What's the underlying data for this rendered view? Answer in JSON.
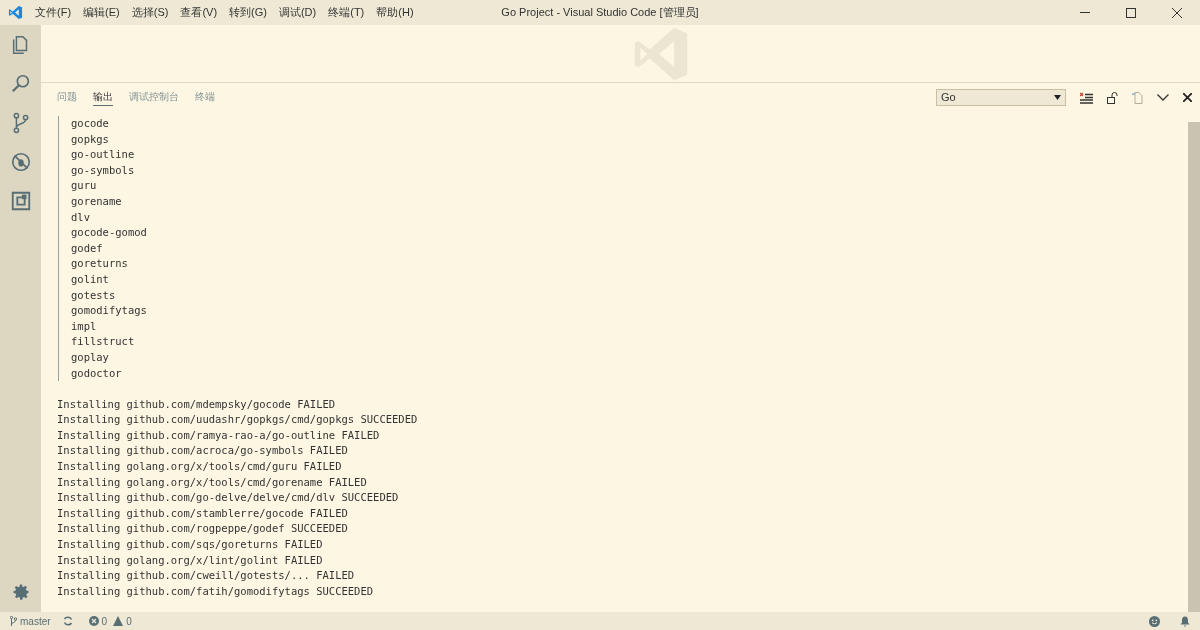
{
  "window": {
    "title": "Go Project - Visual Studio Code [管理员]"
  },
  "menu": [
    "文件(F)",
    "编辑(E)",
    "选择(S)",
    "查看(V)",
    "转到(G)",
    "调试(D)",
    "终端(T)",
    "帮助(H)"
  ],
  "activity_bar": [
    {
      "kind": "files"
    },
    {
      "kind": "search"
    },
    {
      "kind": "git"
    },
    {
      "kind": "debug"
    },
    {
      "kind": "extensions"
    }
  ],
  "panel": {
    "tabs": [
      {
        "label": "问题",
        "selected": false
      },
      {
        "label": "输出",
        "selected": true
      },
      {
        "label": "调试控制台",
        "selected": false
      },
      {
        "label": "终端",
        "selected": false
      }
    ],
    "channel_select": {
      "value": "Go"
    },
    "output": [
      {
        "kind": "indented",
        "lines": [
          "gocode",
          "gopkgs",
          "go-outline",
          "go-symbols",
          "guru",
          "gorename",
          "dlv",
          "gocode-gomod",
          "godef",
          "goreturns",
          "golint",
          "gotests",
          "gomodifytags",
          "impl",
          "fillstruct",
          "goplay",
          "godoctor"
        ]
      },
      {
        "kind": "plain",
        "lines": [
          "Installing github.com/mdempsky/gocode FAILED",
          "Installing github.com/uudashr/gopkgs/cmd/gopkgs SUCCEEDED",
          "Installing github.com/ramya-rao-a/go-outline FAILED",
          "Installing github.com/acroca/go-symbols FAILED",
          "Installing golang.org/x/tools/cmd/guru FAILED",
          "Installing golang.org/x/tools/cmd/gorename FAILED",
          "Installing github.com/go-delve/delve/cmd/dlv SUCCEEDED",
          "Installing github.com/stamblerre/gocode FAILED",
          "Installing github.com/rogpeppe/godef SUCCEEDED",
          "Installing github.com/sqs/goreturns FAILED",
          "Installing golang.org/x/lint/golint FAILED",
          "Installing github.com/cweill/gotests/... FAILED",
          "Installing github.com/fatih/gomodifytags SUCCEEDED"
        ]
      }
    ]
  },
  "status_bar": {
    "branch": "master",
    "errors": "0",
    "warnings": "0"
  }
}
